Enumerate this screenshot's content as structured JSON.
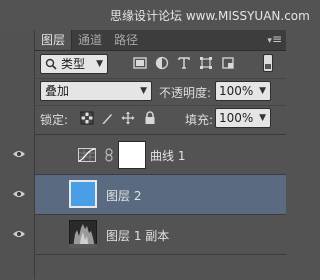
{
  "watermark": "思缘设计论坛 www.MISSYUAN.com",
  "tabs": [
    {
      "label": "图层",
      "active": true
    },
    {
      "label": "通道",
      "active": false
    },
    {
      "label": "路径",
      "active": false
    }
  ],
  "panel_menu_icon": "panel-menu-icon",
  "filter": {
    "kind_label": "类型",
    "icons": [
      "image-filter-icon",
      "adjustment-filter-icon",
      "type-filter-icon",
      "shape-filter-icon",
      "smart-object-filter-icon"
    ]
  },
  "blend": {
    "mode": "叠加",
    "opacity_label": "不透明度:",
    "opacity_value": "100%"
  },
  "lock": {
    "label": "锁定:",
    "fill_label": "填充:",
    "fill_value": "100%"
  },
  "layers": [
    {
      "name": "曲线 1",
      "type": "adjustment",
      "visible": true,
      "selected": false
    },
    {
      "name": "图层 2",
      "type": "pixel",
      "visible": true,
      "selected": true
    },
    {
      "name": "图层 1 副本",
      "type": "pixel",
      "visible": true,
      "selected": false
    }
  ],
  "colors": {
    "panel_bg": "#535353",
    "tab_bar": "#3d3d3d",
    "selected_row": "#5a6b81",
    "layer2_fill": "#4a9ee6",
    "mask_white": "#ffffff"
  }
}
